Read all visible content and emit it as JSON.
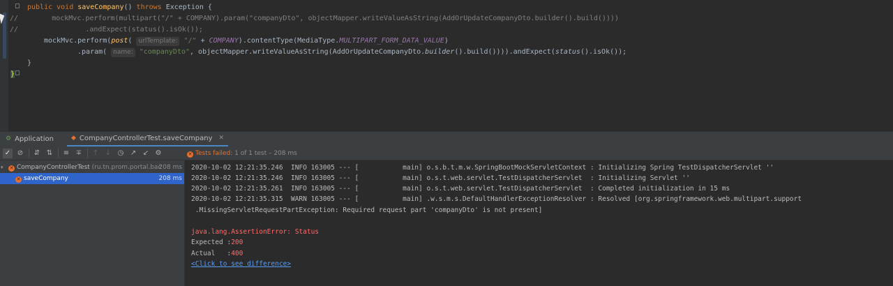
{
  "editor": {
    "line1": {
      "kw1": "public void ",
      "fn": "saveCompany",
      "mid": "() ",
      "kw2": "throws ",
      "tail": "Exception {"
    },
    "line2": "//        mockMvc.perform(multipart(\"/\" + COMPANY).param(\"companyDto\", objectMapper.writeValueAsString(AddOrUpdateCompanyDto.builder().build())))",
    "line3": "//                .andExpect(status().isOk());",
    "line4": {
      "a": "mockMvc.perform(",
      "b": "post",
      "c": "( ",
      "hint": "urlTemplate:",
      "d": " ",
      "str": "\"/\"",
      "e": " + ",
      "const1": "COMPANY",
      "f": ").contentType(MediaType.",
      "const2": "MULTIPART_FORM_DATA_VALUE",
      "g": ")"
    },
    "line5": {
      "a": ".param( ",
      "hint": "name:",
      "str": " \"companyDto\"",
      "b": ", objectMapper.writeValueAsString(AddOrUpdateCompanyDto.",
      "c": "builder",
      "d": "().build()))).andExpect(",
      "e": "status",
      "f": "().isOk());"
    },
    "line6": "}",
    "line7": "}"
  },
  "tabs": [
    {
      "label": "Application",
      "icon": "run-icon"
    },
    {
      "label": "CompanyControllerTest.saveCompany",
      "icon": "test-icon"
    }
  ],
  "toolbar": {
    "icons": [
      "check-icon",
      "stop-icon",
      "sort-alpha-icon",
      "sort-duration-icon",
      "expand-all-icon",
      "collapse-all-icon",
      "prev-failed-icon",
      "next-failed-icon",
      "history-icon",
      "export-icon",
      "import-icon",
      "settings-icon"
    ]
  },
  "status": {
    "failed": "Tests failed:",
    "detail": " 1 of 1 test – 208 ms"
  },
  "tree": [
    {
      "name": "CompanyControllerTest",
      "pkg": " (ru.tn.prom.portal.bac",
      "time": "208 ms"
    },
    {
      "name": "saveCompany",
      "time": "208 ms"
    }
  ],
  "console": {
    "lines": [
      "2020-10-02 12:21:35.246  INFO 163005 --- [           main] o.s.b.t.m.w.SpringBootMockServletContext : Initializing Spring TestDispatcherServlet ''",
      "2020-10-02 12:21:35.246  INFO 163005 --- [           main] o.s.t.web.servlet.TestDispatcherServlet  : Initializing Servlet ''",
      "2020-10-02 12:21:35.261  INFO 163005 --- [           main] o.s.t.web.servlet.TestDispatcherServlet  : Completed initialization in 15 ms",
      "2020-10-02 12:21:35.315  WARN 163005 --- [           main] .w.s.m.s.DefaultHandlerExceptionResolver : Resolved [org.springframework.web.multipart.support",
      " .MissingServletRequestPartException: Required request part 'companyDto' is not present]"
    ],
    "error": "java.lang.AssertionError: Status",
    "expected_label": "Expected :",
    "expected_value": "200",
    "actual_label": "Actual   :",
    "actual_value": "400",
    "diff_link": "<Click to see difference>"
  }
}
